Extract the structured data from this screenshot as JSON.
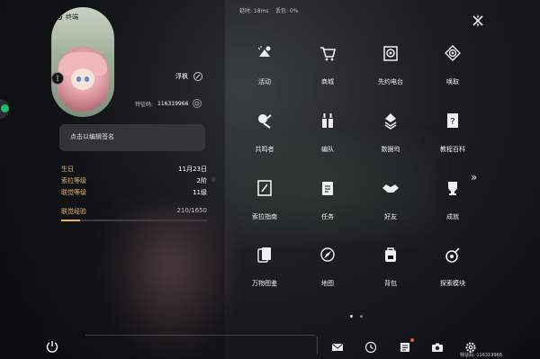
{
  "status": {
    "ping_text": "延时: 18ms",
    "loss_text": "丢包: 0%"
  },
  "profile": {
    "card_title": "终端",
    "name": "浮枫",
    "uid_label": "特征码:",
    "uid_value": "116319966",
    "signature_placeholder": "点击以编辑签名"
  },
  "stats": {
    "birthday_label": "生日",
    "birthday_value": "11月23日",
    "sora_level_label": "索拉等级",
    "sora_level_value": "2阶",
    "union_level_label": "联觉等级",
    "union_level_value": "11级",
    "exp_label": "联觉经验",
    "exp_value": "210/1650",
    "exp_progress": 0.127
  },
  "menu": [
    {
      "label": "活动",
      "icon": "activity-icon"
    },
    {
      "label": "商城",
      "icon": "shop-cart-icon"
    },
    {
      "label": "先约电台",
      "icon": "radio-icon"
    },
    {
      "label": "唤取",
      "icon": "summon-icon"
    },
    {
      "label": "共鸣者",
      "icon": "resonator-icon"
    },
    {
      "label": "编队",
      "icon": "team-icon"
    },
    {
      "label": "数据坞",
      "icon": "data-dock-icon"
    },
    {
      "label": "教程百科",
      "icon": "tutorial-book-icon"
    },
    {
      "label": "索拉指南",
      "icon": "guidebook-icon"
    },
    {
      "label": "任务",
      "icon": "quest-icon"
    },
    {
      "label": "好友",
      "icon": "friends-handshake-icon"
    },
    {
      "label": "成就",
      "icon": "achievement-trophy-icon"
    },
    {
      "label": "万物图鉴",
      "icon": "cards-icon"
    },
    {
      "label": "地图",
      "icon": "compass-icon"
    },
    {
      "label": "背包",
      "icon": "backpack-icon"
    },
    {
      "label": "探索模块",
      "icon": "explore-module-icon"
    }
  ],
  "bottom": {
    "uid_text": "特征码: 116319966"
  },
  "colors": {
    "accent_gold": "#e7b36a",
    "online_green": "#1fb86a",
    "badge_red": "#e25a4b"
  }
}
